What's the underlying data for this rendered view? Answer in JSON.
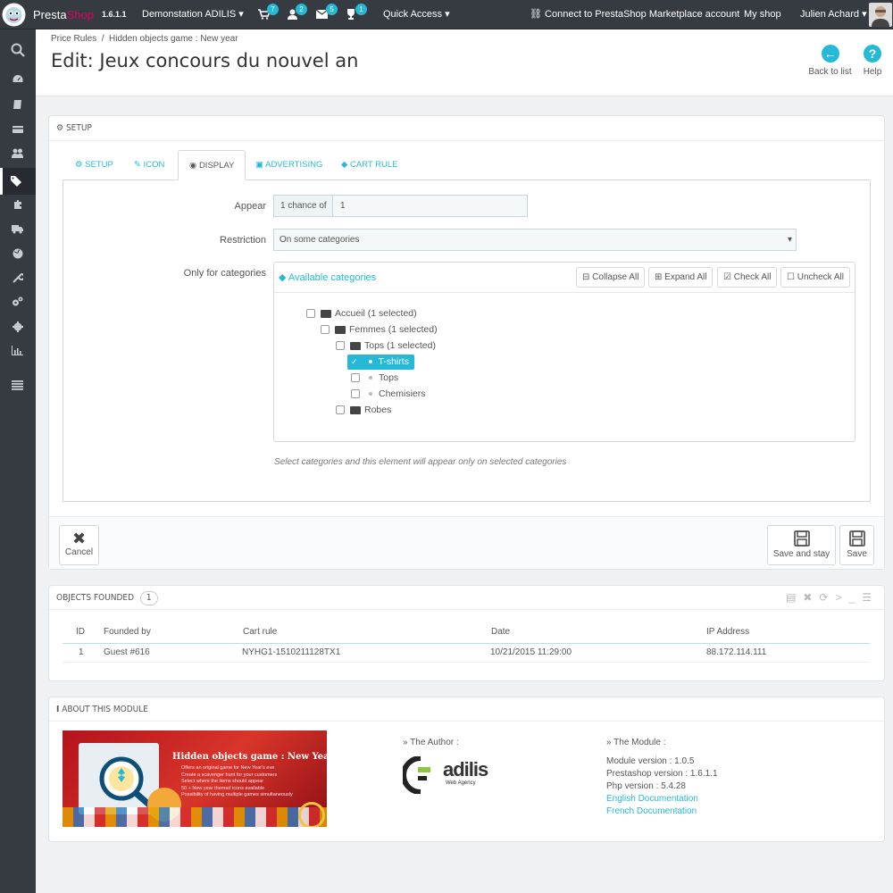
{
  "topbar": {
    "logo": "PrestaShop",
    "logo_presta": "Presta",
    "logo_shop": "Shop",
    "version": "1.6.1.1",
    "shop_dropdown": "Demonstation ADILIS",
    "notifications": [
      {
        "icon": "cart-icon",
        "count": "7"
      },
      {
        "icon": "user-icon",
        "count": "2"
      },
      {
        "icon": "envelope-icon",
        "count": "5"
      },
      {
        "icon": "trophy-icon",
        "count": "1"
      }
    ],
    "quick_access": "Quick Access",
    "connect": "Connect to PrestaShop Marketplace account",
    "my_shop": "My shop",
    "user": "Julien Achard"
  },
  "sidebar": {
    "items": [
      "search-icon",
      "dashboard-icon",
      "catalog-icon",
      "orders-icon",
      "customers-icon",
      "price-rules-icon",
      "modules-icon",
      "shipping-icon",
      "localization-icon",
      "preferences-icon",
      "advanced-icon",
      "administration-icon",
      "stats-icon",
      "menu-collapse-icon"
    ],
    "active_index": 5
  },
  "header": {
    "breadcrumb": [
      "Price Rules",
      "Hidden objects game : New year"
    ],
    "breadcrumb_sep": "/",
    "title": "Edit: Jeux concours du nouvel an",
    "back_label": "Back to list",
    "help_label": "Help"
  },
  "setup_panel": {
    "heading": "SETUP",
    "tabs": [
      {
        "label": "SETUP",
        "icon": "gears-icon"
      },
      {
        "label": "ICON",
        "icon": "brush-icon"
      },
      {
        "label": "DISPLAY",
        "icon": "eye-icon"
      },
      {
        "label": "ADVERTISING",
        "icon": "picture-icon"
      },
      {
        "label": "CART RULE",
        "icon": "tag-icon"
      }
    ],
    "active_tab": "DISPLAY",
    "appear_label": "Appear",
    "appear_prefix": "1 chance of",
    "appear_value": "1",
    "restriction_label": "Restriction",
    "restriction_value": "On some categories",
    "categories_label": "Only for categories",
    "available_categories": "Available categories",
    "collapse_all": "Collapse All",
    "expand_all": "Expand All",
    "check_all": "Check All",
    "uncheck_all": "Uncheck All",
    "tree": {
      "accueil": "Accueil (1 selected)",
      "femmes": "Femmes (1 selected)",
      "tops_folder": "Tops (1 selected)",
      "tshirts": "T-shirts",
      "tops": "Tops",
      "chemisiers": "Chemisiers",
      "robes": "Robes"
    },
    "help_text": "Select categories and this element will appear only on selected categories",
    "cancel": "Cancel",
    "save_and_stay": "Save and stay",
    "save": "Save"
  },
  "objects_panel": {
    "heading": "OBJECTS FOUNDED",
    "count": "1",
    "columns": [
      "ID",
      "Founded by",
      "Cart rule",
      "Date",
      "IP Address"
    ],
    "rows": [
      [
        "1",
        "Guest #616",
        "NYHG1-1510211128TX1",
        "10/21/2015 11:29:00",
        "88.172.114.111"
      ]
    ]
  },
  "about_panel": {
    "heading": "ABOUT THIS MODULE",
    "banner": {
      "title": "Hidden objects game : New Year",
      "lines": [
        "Offers an original game for New Year's eve",
        "Create a scavenger hunt for your customers",
        "Select where the items should appear",
        "50 + New year themed icons available",
        "Possibility of having multiple games simultaneously"
      ]
    },
    "author_heading": "» The Author :",
    "author_name": "adilis",
    "author_sub": "Web Agency",
    "module_heading": "» The Module :",
    "module_version": "Module version : 1.0.5",
    "prestashop_version": "Prestashop version : 1.6.1.1",
    "php_version": "Php version : 5.4.28",
    "english_doc": "English Documentation",
    "french_doc": "French Documentation"
  },
  "colors": {
    "accent": "#25b9d7",
    "topbar": "#363a41",
    "brand_pink": "#df0067",
    "selected": "#25b9d7"
  }
}
